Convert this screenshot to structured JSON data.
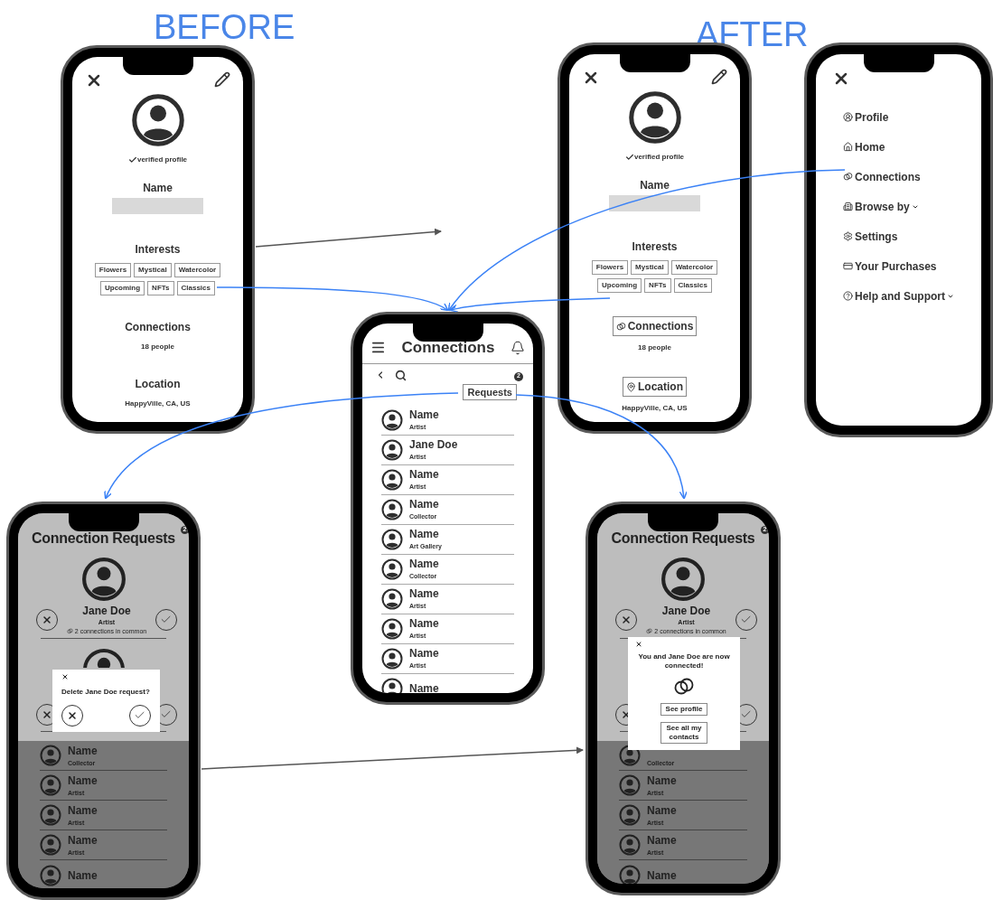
{
  "labels": {
    "before": "BEFORE",
    "after": "AFTER"
  },
  "profile_before": {
    "verified": "verified profile",
    "name_label": "Name",
    "interests_label": "Interests",
    "interests": [
      "Flowers",
      "Mystical",
      "Watercolor",
      "Upcoming",
      "NFTs",
      "Classics"
    ],
    "sections": [
      {
        "kind": "heading",
        "title": "Connections",
        "detail": "18 people"
      },
      {
        "kind": "heading",
        "title": "Location",
        "detail": "HappyVille, CA, US"
      }
    ]
  },
  "profile_after": {
    "verified": "verified profile",
    "name_label": "Name",
    "interests_label": "Interests",
    "interests": [
      "Flowers",
      "Mystical",
      "Watercolor",
      "Upcoming",
      "NFTs",
      "Classics"
    ],
    "sections": [
      {
        "kind": "link",
        "title": "Connections",
        "detail": "18 people"
      },
      {
        "kind": "link",
        "title": "Location",
        "detail": "HappyVille, CA, US"
      }
    ]
  },
  "connections": {
    "title": "Connections",
    "requests": {
      "label": "Requests",
      "badge": "2"
    },
    "rows": [
      {
        "name": "Name",
        "role": "Artist"
      },
      {
        "name": "Jane Doe",
        "role": "Artist"
      },
      {
        "name": "Name",
        "role": "Artist"
      },
      {
        "name": "Name",
        "role": "Collector"
      },
      {
        "name": "Name",
        "role": "Art Gallery"
      },
      {
        "name": "Name",
        "role": "Collector"
      },
      {
        "name": "Name",
        "role": "Artist"
      },
      {
        "name": "Name",
        "role": "Artist"
      },
      {
        "name": "Name",
        "role": "Artist"
      },
      {
        "name": "Name"
      }
    ]
  },
  "menu": {
    "items": [
      {
        "label": "Profile",
        "expandable": false
      },
      {
        "label": "Home",
        "expandable": false
      },
      {
        "label": "Connections",
        "expandable": false
      },
      {
        "label": "Browse by",
        "expandable": true
      },
      {
        "label": "Settings",
        "expandable": false
      },
      {
        "label": "Your Purchases",
        "expandable": false
      },
      {
        "label": "Help and Support",
        "expandable": true
      }
    ]
  },
  "requests_delete": {
    "title": "Connection Requests",
    "badge": "2",
    "card": {
      "name": "Jane Doe",
      "role": "Artist",
      "common": "2 connections in common"
    },
    "rows": [
      {
        "name": "Name",
        "role": "Collector"
      },
      {
        "name": "Name",
        "role": "Artist"
      },
      {
        "name": "Name",
        "role": "Artist"
      },
      {
        "name": "Name",
        "role": "Artist"
      },
      {
        "name": "Name"
      }
    ],
    "dialog": {
      "kind": "confirm",
      "text": "Delete Jane Doe request?"
    }
  },
  "requests_connected": {
    "title": "Connection Requests",
    "badge": "2",
    "card": {
      "name": "Jane Doe",
      "role": "Artist",
      "common": "2 connections in common"
    },
    "rows": [
      {
        "role": "Collector"
      },
      {
        "name": "Name",
        "role": "Artist"
      },
      {
        "name": "Name",
        "role": "Artist"
      },
      {
        "name": "Name",
        "role": "Artist"
      },
      {
        "name": "Name"
      }
    ],
    "dialog": {
      "kind": "connected",
      "text": "You and Jane Doe are now connected!",
      "buttons": [
        "See profile",
        "See all my contacts"
      ]
    }
  }
}
